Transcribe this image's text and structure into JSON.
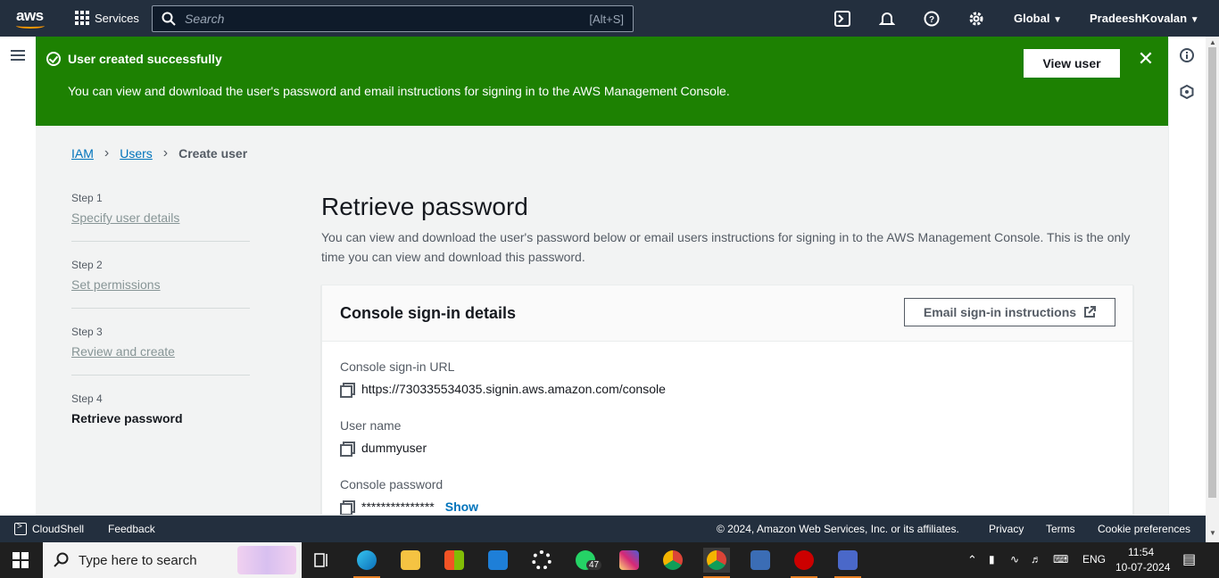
{
  "topnav": {
    "logo": "aws",
    "services_label": "Services",
    "search_placeholder": "Search",
    "search_shortcut": "[Alt+S]",
    "region_label": "Global",
    "account_label": "PradeeshKovalan"
  },
  "flash": {
    "title": "User created successfully",
    "message": "You can view and download the user's password and email instructions for signing in to the AWS Management Console.",
    "view_user_label": "View user",
    "color": "#1d8102"
  },
  "breadcrumb": {
    "items": [
      "IAM",
      "Users",
      "Create user"
    ]
  },
  "steps": [
    {
      "label": "Step 1",
      "name": "Specify user details"
    },
    {
      "label": "Step 2",
      "name": "Set permissions"
    },
    {
      "label": "Step 3",
      "name": "Review and create"
    },
    {
      "label": "Step 4",
      "name": "Retrieve password"
    }
  ],
  "main": {
    "title": "Retrieve password",
    "description": "You can view and download the user's password below or email users instructions for signing in to the AWS Management Console. This is the only time you can view and download this password."
  },
  "card": {
    "title": "Console sign-in details",
    "email_button_label": "Email sign-in instructions",
    "fields": [
      {
        "label": "Console sign-in URL",
        "value": "https://730335534035.signin.aws.amazon.com/console"
      },
      {
        "label": "User name",
        "value": "dummyuser"
      },
      {
        "label": "Console password",
        "value": "***************",
        "show_label": "Show"
      }
    ]
  },
  "footer": {
    "cloudshell": "CloudShell",
    "feedback": "Feedback",
    "copyright": "© 2024, Amazon Web Services, Inc. or its affiliates.",
    "privacy": "Privacy",
    "terms": "Terms",
    "cookie": "Cookie preferences"
  },
  "taskbar": {
    "search_placeholder": "Type here to search",
    "whatsapp_badge": "47",
    "lang": "ENG",
    "time": "11:54",
    "date": "10-07-2024"
  }
}
